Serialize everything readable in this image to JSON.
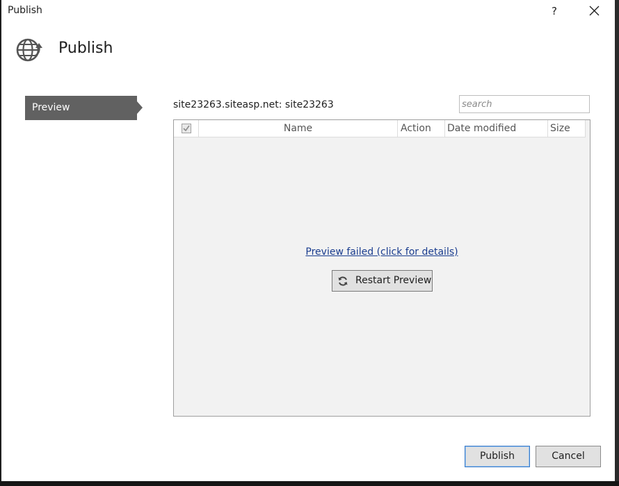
{
  "window": {
    "title": "Publish",
    "help_label": "?"
  },
  "header": {
    "title": "Publish",
    "icon": "globe-publish-icon"
  },
  "nav": {
    "items": [
      {
        "label": "Preview",
        "selected": true
      }
    ]
  },
  "main": {
    "site_label": "site23263.siteasp.net: site23263",
    "search": {
      "placeholder": "search",
      "value": ""
    },
    "grid": {
      "columns": [
        "Name",
        "Action",
        "Date modified",
        "Size"
      ],
      "rows": [],
      "select_all_checked": true
    },
    "error_link": "Preview failed (click for details)",
    "restart_button": {
      "label": "Restart Preview",
      "icon": "refresh-icon"
    }
  },
  "footer": {
    "publish_label": "Publish",
    "cancel_label": "Cancel"
  },
  "colors": {
    "nav_selected": "#616161",
    "grid_background": "#f2f2f2",
    "link": "#1a3d8f",
    "primary_border": "#3a7bc8"
  }
}
